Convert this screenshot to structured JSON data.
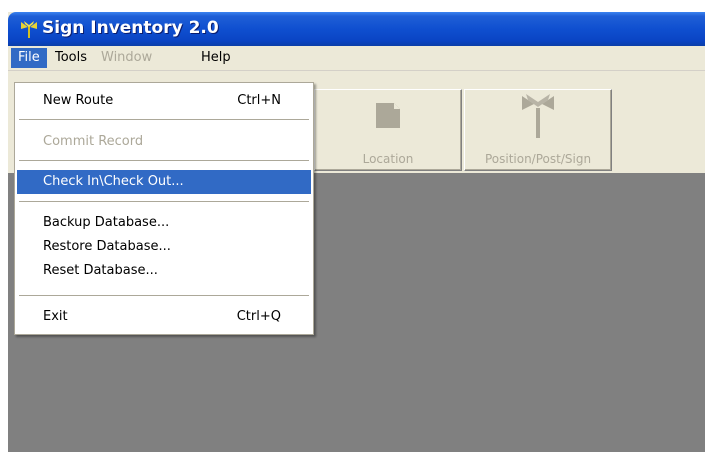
{
  "window": {
    "title": "Sign Inventory 2.0"
  },
  "menubar": {
    "items": [
      {
        "label": "File",
        "state": "active"
      },
      {
        "label": "Tools",
        "state": "normal"
      },
      {
        "label": "Window",
        "state": "disabled"
      },
      {
        "label": "Help",
        "state": "normal"
      }
    ]
  },
  "file_menu": {
    "items": [
      {
        "label": "New Route",
        "shortcut": "Ctrl+N",
        "state": "normal"
      },
      {
        "label": "Commit Record",
        "shortcut": "",
        "state": "disabled"
      },
      {
        "label": "Check In\\Check Out...",
        "shortcut": "",
        "state": "highlighted"
      },
      {
        "label": "Backup Database...",
        "shortcut": "",
        "state": "normal"
      },
      {
        "label": "Restore Database...",
        "shortcut": "",
        "state": "normal"
      },
      {
        "label": "Reset Database...",
        "shortcut": "",
        "state": "normal"
      },
      {
        "label": "Exit",
        "shortcut": "Ctrl+Q",
        "state": "normal"
      }
    ]
  },
  "toolbar": {
    "buttons": [
      {
        "label": "Location",
        "icon": "document-icon",
        "state": "disabled"
      },
      {
        "label": "Position/Post/Sign",
        "icon": "signpost-icon",
        "state": "disabled"
      }
    ]
  },
  "colors": {
    "titlebar": "#0a44c4",
    "menu_highlight": "#316ac5",
    "workspace": "#808080",
    "disabled_text": "#aca899"
  }
}
